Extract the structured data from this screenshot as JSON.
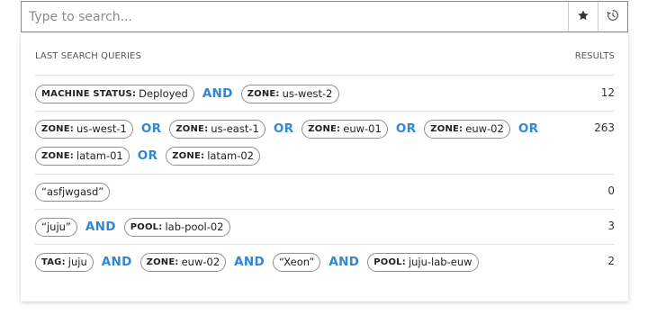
{
  "search": {
    "placeholder": "Type to search...",
    "value": ""
  },
  "header": {
    "queries_label": "LAST SEARCH QUERIES",
    "results_label": "RESULTS"
  },
  "rows": [
    {
      "lines": [
        [
          {
            "type": "chip",
            "key": "MACHINE STATUS:",
            "value": "Deployed"
          },
          {
            "type": "op",
            "text": "AND"
          },
          {
            "type": "chip",
            "key": "ZONE:",
            "value": "us-west-2"
          }
        ]
      ],
      "count": "12"
    },
    {
      "lines": [
        [
          {
            "type": "chip",
            "key": "ZONE:",
            "value": "us-west-1"
          },
          {
            "type": "op",
            "text": "OR"
          },
          {
            "type": "chip",
            "key": "ZONE:",
            "value": "us-east-1"
          },
          {
            "type": "op",
            "text": "OR"
          },
          {
            "type": "chip",
            "key": "ZONE:",
            "value": "euw-01"
          },
          {
            "type": "op",
            "text": "OR"
          },
          {
            "type": "chip",
            "key": "ZONE:",
            "value": "euw-02"
          },
          {
            "type": "op",
            "text": "OR"
          }
        ],
        [
          {
            "type": "chip",
            "key": "ZONE:",
            "value": "latam-01"
          },
          {
            "type": "op",
            "text": "OR"
          },
          {
            "type": "chip",
            "key": "ZONE:",
            "value": "latam-02"
          }
        ]
      ],
      "count": "263"
    },
    {
      "lines": [
        [
          {
            "type": "chip",
            "key": "",
            "value": "“asfjwgasd”"
          }
        ]
      ],
      "count": "0"
    },
    {
      "lines": [
        [
          {
            "type": "chip",
            "key": "",
            "value": "“juju”"
          },
          {
            "type": "op",
            "text": "AND"
          },
          {
            "type": "chip",
            "key": "POOL:",
            "value": "lab-pool-02"
          }
        ]
      ],
      "count": "3"
    },
    {
      "lines": [
        [
          {
            "type": "chip",
            "key": "TAG:",
            "value": "juju"
          },
          {
            "type": "op",
            "text": "AND"
          },
          {
            "type": "chip",
            "key": "ZONE:",
            "value": "euw-02"
          },
          {
            "type": "op",
            "text": "AND"
          },
          {
            "type": "chip",
            "key": "",
            "value": "“Xeon”"
          },
          {
            "type": "op",
            "text": "AND"
          },
          {
            "type": "chip",
            "key": "POOL:",
            "value": "juju-lab-euw"
          }
        ]
      ],
      "count": "2"
    }
  ],
  "colors": {
    "operator": "#2f86d8",
    "chip_border": "#8f8f8f",
    "divider": "#e2e2e2"
  },
  "icons": {
    "favorite": "star-icon",
    "history": "recent-history-icon"
  }
}
